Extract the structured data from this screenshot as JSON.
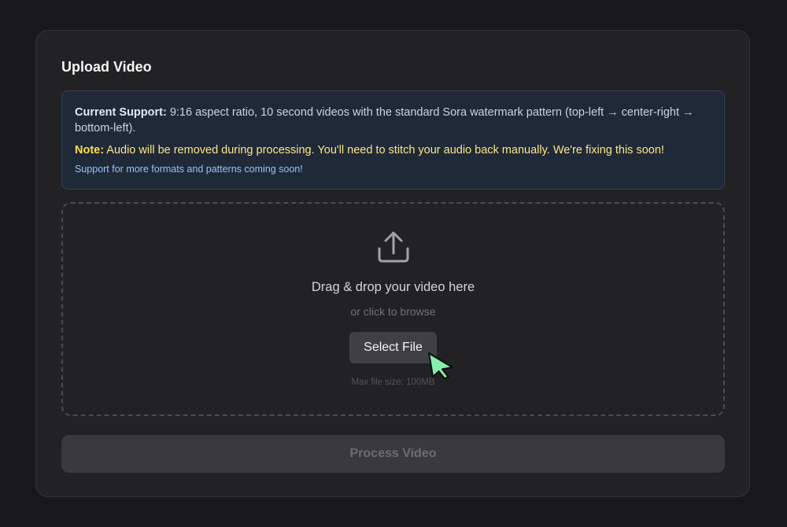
{
  "card": {
    "title": "Upload Video"
  },
  "info": {
    "support_label": "Current Support:",
    "support_text": " 9:16 aspect ratio, 10 second videos with the standard Sora watermark pattern (top-left → center-right → bottom-left).",
    "note_label": "Note:",
    "note_text": " Audio will be removed during processing. You'll need to stitch your audio back manually. We're fixing this soon!",
    "more_text": "Support for more formats and patterns coming soon!"
  },
  "dropzone": {
    "icon": "upload-icon",
    "title": "Drag & drop your video here",
    "subtitle": "or click to browse",
    "select_label": "Select File",
    "max_size": "Max file size: 100MB"
  },
  "process": {
    "label": "Process Video",
    "disabled": true
  },
  "cursor": {
    "icon": "pointer-cursor-icon",
    "color": "#86efac"
  },
  "colors": {
    "background": "#18181b",
    "card": "#222224",
    "info_background": "#1f2937",
    "note_accent": "#fde047",
    "link_accent": "#93c5fd"
  }
}
